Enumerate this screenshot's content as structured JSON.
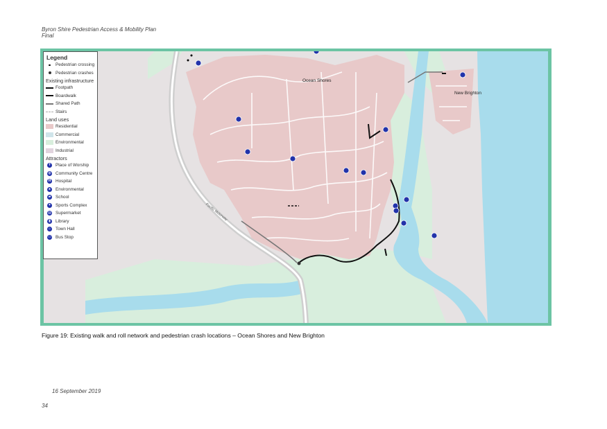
{
  "header": {
    "line1": "Byron Shire Pedestrian Access & Mobility Plan",
    "line2": "Final"
  },
  "legend": {
    "title": "Legend",
    "crash_items": [
      {
        "label": "Pedestrian crossing",
        "icon": "small-dot-icon"
      },
      {
        "label": "Pedestrian crashes",
        "icon": "crash-dot-icon"
      }
    ],
    "infra_title": "Existing infrastructure",
    "infra_items": [
      {
        "label": "Footpath",
        "style": "solid"
      },
      {
        "label": "Boardwalk",
        "style": "dash"
      },
      {
        "label": "Shared Path",
        "style": "shared"
      },
      {
        "label": "Stairs",
        "style": "stairs"
      }
    ],
    "land_title": "Land uses",
    "land_items": [
      {
        "label": "Residential",
        "color": "#e8c9c9"
      },
      {
        "label": "Commercial",
        "color": "#cfe4ea"
      },
      {
        "label": "Environmental",
        "color": "#d8eedd"
      },
      {
        "label": "Industrial",
        "color": "#e1d4de"
      }
    ],
    "attr_title": "Attractors",
    "attr_items": [
      {
        "label": "Place of Worship",
        "icon": "worship-icon",
        "glyph": "✝"
      },
      {
        "label": "Community Centre",
        "icon": "community-icon",
        "glyph": "◍"
      },
      {
        "label": "Hospital",
        "icon": "hospital-icon",
        "glyph": "H"
      },
      {
        "label": "Environmental",
        "icon": "environmental-icon",
        "glyph": "♠"
      },
      {
        "label": "School",
        "icon": "school-icon",
        "glyph": "▰"
      },
      {
        "label": "Sports Complex",
        "icon": "sports-icon",
        "glyph": "✦"
      },
      {
        "label": "Supermarket",
        "icon": "supermarket-icon",
        "glyph": "▤"
      },
      {
        "label": "Library",
        "icon": "library-icon",
        "glyph": "▮"
      },
      {
        "label": "Town Hall",
        "icon": "town-hall-icon",
        "glyph": "⌂"
      },
      {
        "label": "Bus Stop",
        "icon": "bus-stop-icon",
        "glyph": "▭"
      }
    ]
  },
  "map": {
    "place_ocean_shores": "Ocean Shores",
    "place_new_brighton": "New Brighton",
    "road_label": "Pacific Motorway",
    "colors": {
      "residential": "#e8c9c9",
      "environmental": "#d8eedd",
      "water": "#a8dcec",
      "frame": "#6cc4a4"
    }
  },
  "caption": "Figure 19: Existing walk and roll network and pedestrian crash locations – Ocean Shores and New Brighton",
  "footer": {
    "date": "16 September 2019",
    "page": "34"
  }
}
